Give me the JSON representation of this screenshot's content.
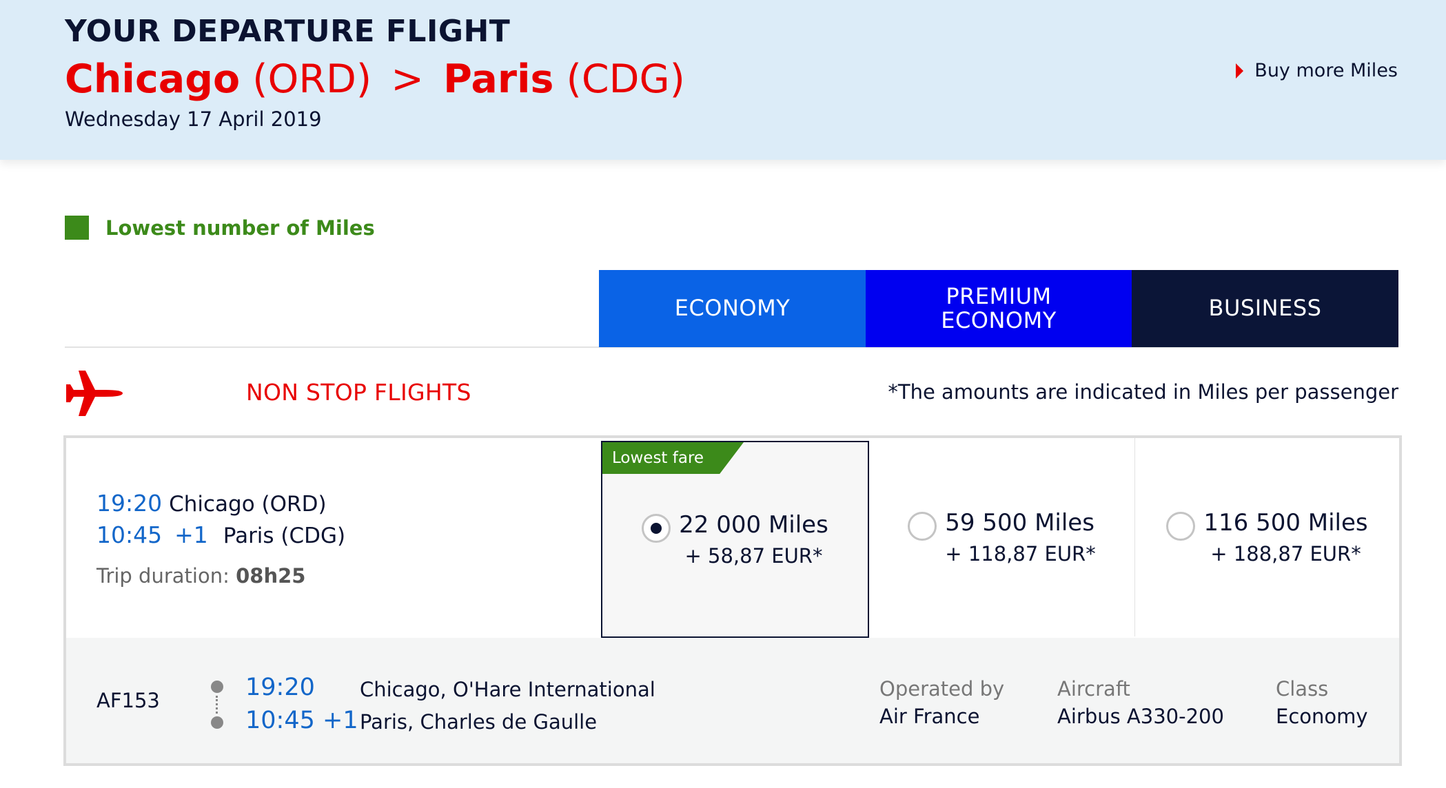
{
  "header": {
    "title": "YOUR DEPARTURE FLIGHT",
    "origin_city": "Chicago",
    "origin_code": "(ORD)",
    "separator": ">",
    "dest_city": "Paris",
    "dest_code": "(CDG)",
    "date": "Wednesday 17 April 2019",
    "buy_more_label": "Buy more Miles"
  },
  "legend": {
    "label": "Lowest number of Miles",
    "color": "#3c8a1a"
  },
  "tabs": [
    {
      "label": "ECONOMY",
      "color": "#0a63e6"
    },
    {
      "label": "PREMIUM ECONOMY",
      "color": "#0000f0"
    },
    {
      "label": "BUSINESS",
      "color": "#0b1537"
    }
  ],
  "section": {
    "heading": "NON STOP FLIGHTS",
    "note": "*The amounts are indicated in Miles per passenger",
    "icon": "airplane-icon"
  },
  "flight": {
    "dep_time": "19:20",
    "dep_city": "Chicago (ORD)",
    "arr_time": "10:45",
    "arr_day_offset": "+1",
    "arr_city": "Paris (CDG)",
    "duration_label": "Trip duration:",
    "duration_value": "08h25",
    "fares": [
      {
        "miles": "22 000 Miles",
        "eur": "+ 58,87 EUR*",
        "selected": true,
        "badge": "Lowest fare"
      },
      {
        "miles": "59 500 Miles",
        "eur": "+ 118,87 EUR*",
        "selected": false
      },
      {
        "miles": "116 500 Miles",
        "eur": "+ 188,87 EUR*",
        "selected": false
      }
    ],
    "segment": {
      "flight_number": "AF153",
      "dep_time": "19:20",
      "arr_time": "10:45 +1",
      "dep_airport": "Chicago, O'Hare International",
      "arr_airport": "Paris, Charles de Gaulle",
      "operated_label": "Operated by",
      "operated_value": "Air France",
      "aircraft_label": "Aircraft",
      "aircraft_value": "Airbus A330-200",
      "class_label": "Class",
      "class_value": "Economy"
    }
  }
}
